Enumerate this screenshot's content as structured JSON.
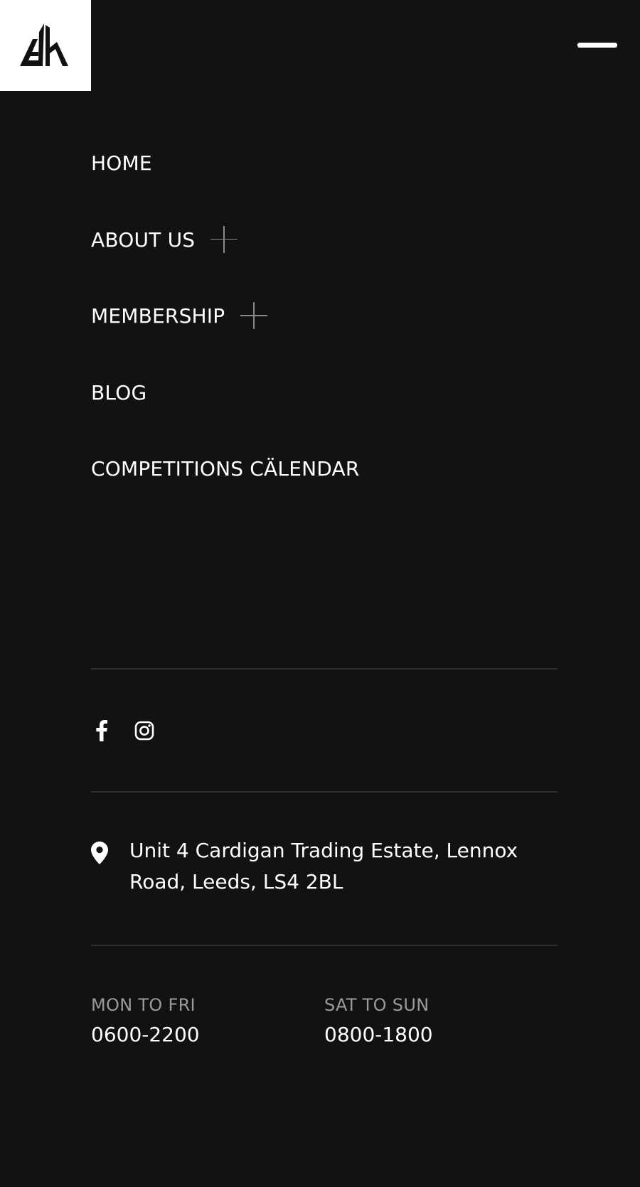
{
  "header": {
    "logo_name": "gh-logo",
    "menu_toggle_icon": "close-menu-icon"
  },
  "nav": {
    "items": [
      {
        "label": "HOME",
        "has_submenu": false
      },
      {
        "label": "ABOUT US",
        "has_submenu": true
      },
      {
        "label": "MEMBERSHIP",
        "has_submenu": true
      },
      {
        "label": "BLOG",
        "has_submenu": false
      },
      {
        "label": "COMPETITIONS CÄLENDAR",
        "has_submenu": false
      }
    ]
  },
  "social": {
    "icons": [
      "facebook-icon",
      "instagram-icon"
    ]
  },
  "address": {
    "icon": "map-pin-icon",
    "line1": "Unit 4 Cardigan Trading Estate, Lennox",
    "line2": "Road, Leeds, LS4 2BL"
  },
  "hours": {
    "weekday_label": "MON TO FRI",
    "weekday_value": "0600-2200",
    "weekend_label": "SAT TO SUN",
    "weekend_value": "0800-1800"
  },
  "colors": {
    "background": "#121212",
    "text": "#ffffff",
    "muted_text": "#9a9a9a",
    "divider": "#2e2e2e",
    "logo_bg": "#ffffff",
    "logo_mark": "#111111"
  }
}
